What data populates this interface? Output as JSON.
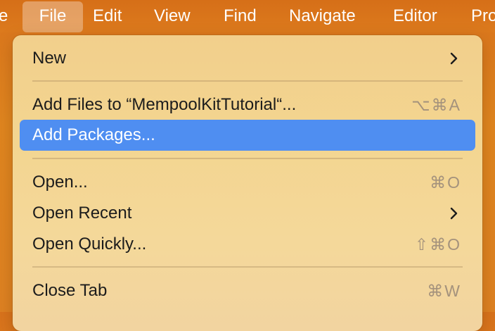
{
  "menubar": {
    "items": [
      {
        "label": "e"
      },
      {
        "label": "File"
      },
      {
        "label": "Edit"
      },
      {
        "label": "View"
      },
      {
        "label": "Find"
      },
      {
        "label": "Navigate"
      },
      {
        "label": "Editor"
      },
      {
        "label": "Pro"
      }
    ],
    "active_item": "File"
  },
  "file_menu": {
    "items": [
      {
        "label": "New",
        "shortcut": "",
        "submenu": true
      },
      {
        "label": "Add Files to “MempoolKitTutorial“...",
        "shortcut": "⌥⌘A",
        "submenu": false
      },
      {
        "label": "Add Packages...",
        "shortcut": "",
        "submenu": false,
        "highlighted": true
      },
      {
        "label": "Open...",
        "shortcut": "⌘O",
        "submenu": false
      },
      {
        "label": "Open Recent",
        "shortcut": "",
        "submenu": true
      },
      {
        "label": "Open Quickly...",
        "shortcut": "⇧⌘O",
        "submenu": false
      },
      {
        "label": "Close Tab",
        "shortcut": "⌘W",
        "submenu": false
      }
    ]
  },
  "colors": {
    "highlight": "#4f8ef1",
    "menu_background": "#f3d590",
    "menubar_background": "#d9731c",
    "shortcut_text": "#a4927c"
  },
  "icons": {
    "submenu": "chevron-right-icon"
  }
}
